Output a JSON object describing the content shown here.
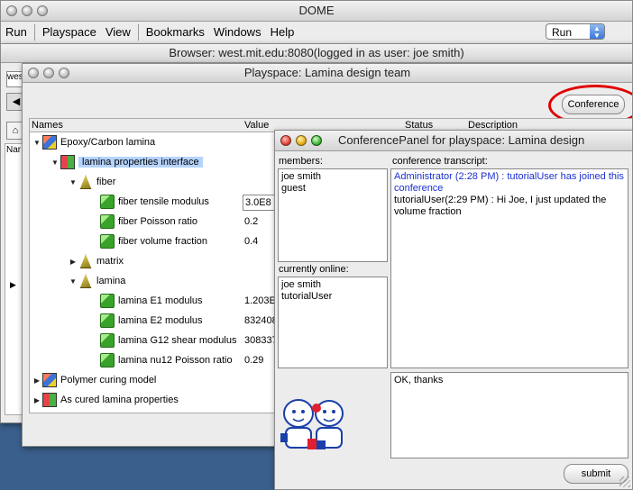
{
  "dome": {
    "title": "DOME",
    "menu": [
      "Run",
      "Playspace",
      "View",
      "Bookmarks",
      "Windows",
      "Help"
    ],
    "run_select": "Run"
  },
  "browser": {
    "title": "Browser: west.mit.edu:8080(logged in as user: joe smith)",
    "input_value": "wes",
    "list_header": "Nar"
  },
  "playspace": {
    "title": "Playspace: Lamina design team",
    "conference_button": "Conference",
    "columns": [
      "Names",
      "Value",
      "Status",
      "Description"
    ],
    "tree": [
      {
        "label": "Epoxy/Carbon lamina",
        "value": ""
      },
      {
        "label": "lamina properties interface",
        "value": ""
      },
      {
        "label": "fiber",
        "value": ""
      },
      {
        "label": "fiber tensile modulus",
        "value": "3.0E8"
      },
      {
        "label": "fiber Poisson ratio",
        "value": "0.2"
      },
      {
        "label": "fiber volume fraction",
        "value": "0.4"
      },
      {
        "label": "matrix",
        "value": ""
      },
      {
        "label": "lamina",
        "value": ""
      },
      {
        "label": "lamina E1 modulus",
        "value": "1.203E"
      },
      {
        "label": "lamina E2 modulus",
        "value": "832408"
      },
      {
        "label": "lamina G12 shear modulus",
        "value": "308337"
      },
      {
        "label": "lamina nu12 Poisson ratio",
        "value": "0.29"
      },
      {
        "label": "Polymer curing model",
        "value": ""
      },
      {
        "label": "As cured lamina properties",
        "value": ""
      }
    ]
  },
  "conference": {
    "title": "ConferencePanel for playspace: Lamina design",
    "members_label": "members:",
    "members": [
      "joe smith",
      "guest"
    ],
    "online_label": "currently online:",
    "online": [
      "joe smith",
      "tutorialUser"
    ],
    "transcript_label": "conference transcript:",
    "transcript": [
      {
        "text": "Administrator (2:28 PM) :   tutorialUser has joined this conference",
        "kind": "admin"
      },
      {
        "text": "tutorialUser(2:29 PM) :   Hi Joe, I just updated the volume fraction",
        "kind": "user"
      }
    ],
    "message": "OK, thanks",
    "submit": "submit"
  }
}
